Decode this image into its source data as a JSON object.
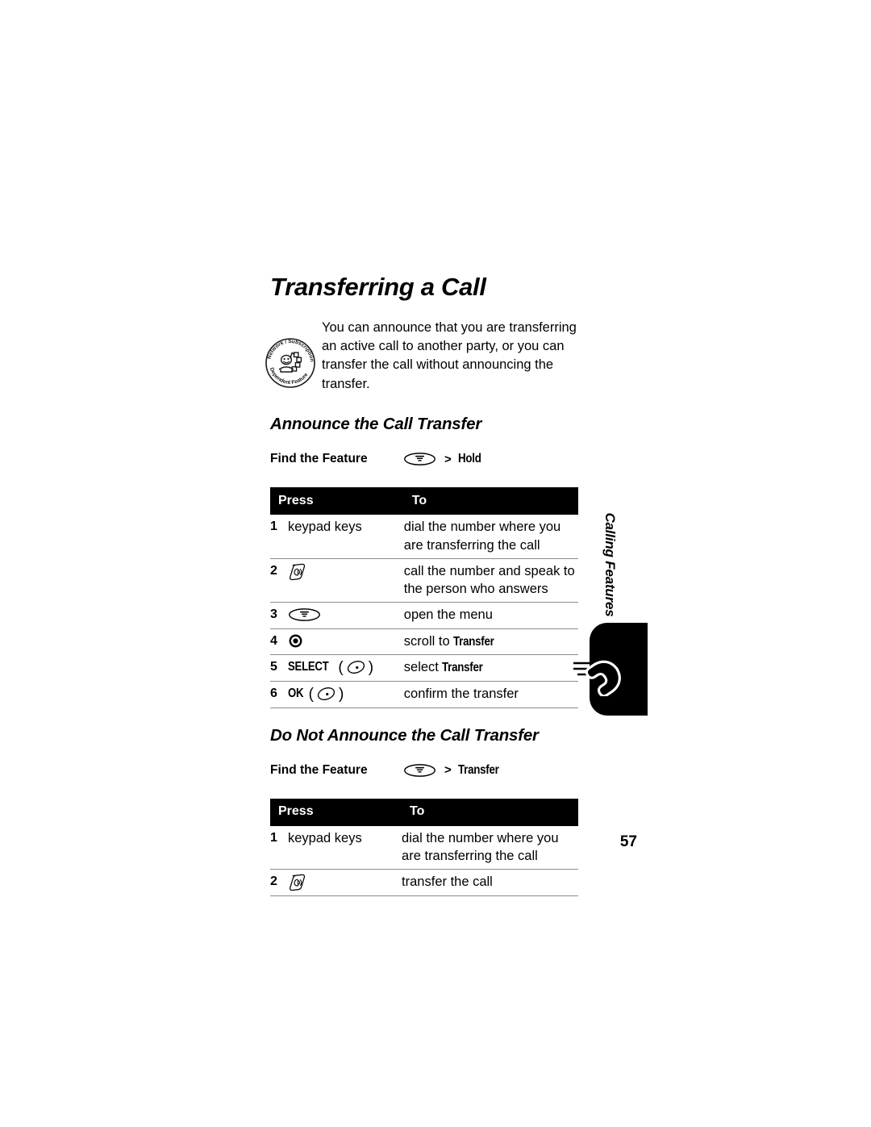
{
  "document": {
    "chapter_title": "Transferring a Call",
    "intro_paragraph": "You can announce that you are transferring an active call to another party, or you can transfer the call without announcing the transfer.",
    "badge_icon": "network-subscription-dependent-feature-icon",
    "badge_text_top": "Network / Subscription",
    "badge_text_bottom": "Dependent Feature",
    "page_number": "57"
  },
  "side_tab": {
    "label": "Calling Features",
    "icon": "ringing-telephone-handset-icon"
  },
  "sections": [
    {
      "heading": "Announce the Call Transfer",
      "find_feature": {
        "label": "Find the Feature",
        "key_icon": "menu-key-icon",
        "separator": ">",
        "items": [
          "Hold"
        ]
      },
      "table": {
        "headers": [
          "Press",
          "To"
        ],
        "rows": [
          {
            "num": "1",
            "press_text": "keypad keys",
            "press_icon": "",
            "press_key_label": "",
            "to_text": "dial the number where you are transferring the call",
            "to_bold": ""
          },
          {
            "num": "2",
            "press_text": "",
            "press_icon": "send-key-icon",
            "press_key_label": "",
            "to_text": "call the number and speak to the person who answers",
            "to_bold": ""
          },
          {
            "num": "3",
            "press_text": "",
            "press_icon": "menu-key-icon",
            "press_key_label": "",
            "to_text": "open the menu",
            "to_bold": ""
          },
          {
            "num": "4",
            "press_text": "",
            "press_icon": "navigation-key-icon",
            "press_key_label": "",
            "to_text": "scroll to ",
            "to_bold": "Transfer"
          },
          {
            "num": "5",
            "press_text": "",
            "press_icon": "soft-key-icon",
            "press_key_label": "SELECT",
            "to_text": "select ",
            "to_bold": "Transfer"
          },
          {
            "num": "6",
            "press_text": "",
            "press_icon": "soft-key-icon",
            "press_key_label": "OK",
            "to_text": "confirm the transfer",
            "to_bold": ""
          }
        ]
      }
    },
    {
      "heading": "Do Not Announce the Call Transfer",
      "find_feature": {
        "label": "Find the Feature",
        "key_icon": "menu-key-icon",
        "separator": ">",
        "items": [
          "Transfer"
        ]
      },
      "table": {
        "headers": [
          "Press",
          "To"
        ],
        "rows": [
          {
            "num": "1",
            "press_text": "keypad keys",
            "press_icon": "",
            "press_key_label": "",
            "to_text": "dial the number where you are transferring the call",
            "to_bold": ""
          },
          {
            "num": "2",
            "press_text": "",
            "press_icon": "send-key-icon",
            "press_key_label": "",
            "to_text": "transfer the call",
            "to_bold": ""
          }
        ]
      }
    }
  ],
  "colors": {
    "header_bar": "#000000",
    "header_text": "#ffffff",
    "rule": "#8c8c8c",
    "body_text": "#000000",
    "page_background": "#ffffff"
  }
}
